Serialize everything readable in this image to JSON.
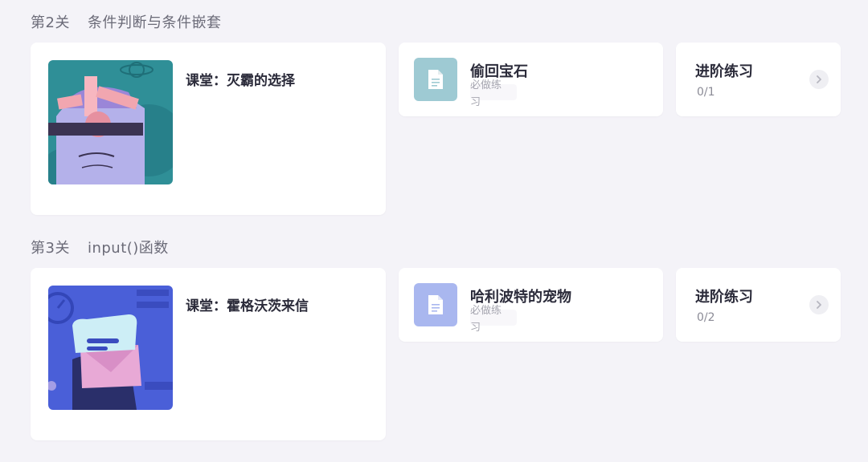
{
  "levels": [
    {
      "level_label": "第2关",
      "level_name": "条件判断与条件嵌套",
      "lesson_title": "课堂：灭霸的选择",
      "task": {
        "title": "偷回宝石",
        "subtitle": "必做练习",
        "icon": "document-icon",
        "icon_bg": "#9ecad3"
      },
      "practice": {
        "title": "进阶练习",
        "progress": "0/1"
      }
    },
    {
      "level_label": "第3关",
      "level_name": "input()函数",
      "lesson_title": "课堂：霍格沃茨来信",
      "task": {
        "title": "哈利波特的宠物",
        "subtitle": "必做练习",
        "icon": "document-icon",
        "icon_bg": "#a9b7ef"
      },
      "practice": {
        "title": "进阶练习",
        "progress": "0/2"
      }
    }
  ],
  "colors": {
    "page_bg": "#f4f3f8",
    "card_bg": "#ffffff",
    "text_primary": "#2b2b3a",
    "text_secondary": "#8b8b96"
  }
}
